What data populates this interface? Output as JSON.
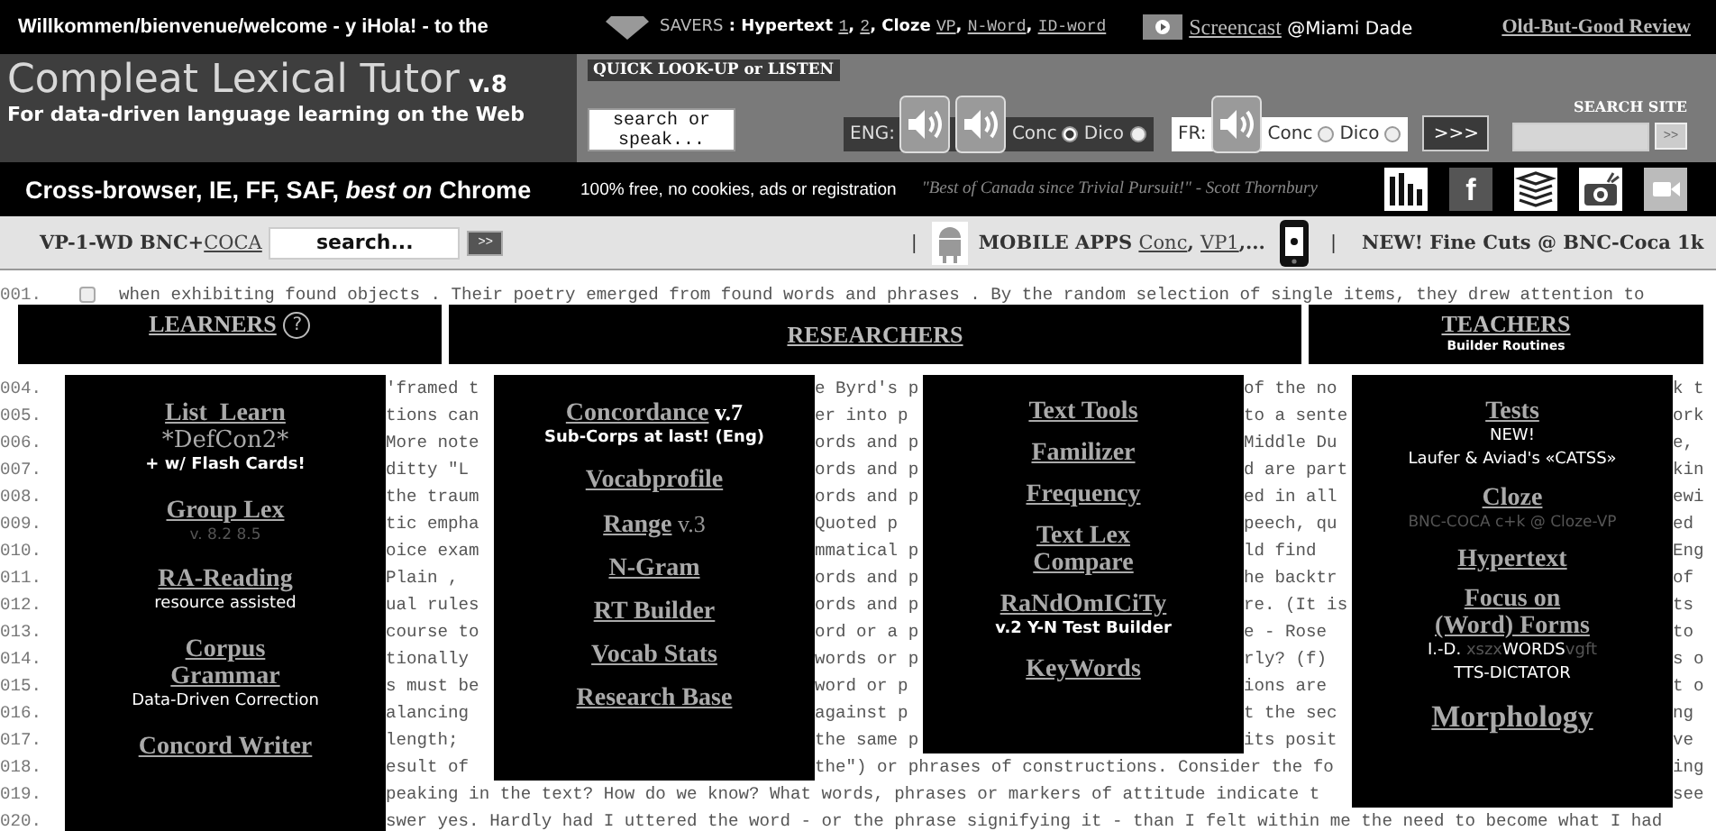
{
  "welcome_bar": {
    "greeting": "Willkommen/bienvenue/welcome - y iHola! - to the",
    "savers": [
      {
        "kind": "label",
        "text": "SAVERS"
      },
      {
        "kind": "text",
        "text": " : Hypertext "
      },
      {
        "kind": "link",
        "text": "1"
      },
      {
        "kind": "text",
        "text": ", "
      },
      {
        "kind": "link",
        "text": "2"
      },
      {
        "kind": "text",
        "text": ", Cloze "
      },
      {
        "kind": "link",
        "text": "VP"
      },
      {
        "kind": "text",
        "text": ", "
      },
      {
        "kind": "link",
        "text": "N-Word"
      },
      {
        "kind": "text",
        "text": ", "
      },
      {
        "kind": "link",
        "text": "ID-word"
      }
    ],
    "screencast": {
      "link": "Screencast",
      "place": " @Miami Dade"
    },
    "review_link": "Old-But-Good Review"
  },
  "title_band": {
    "title": "Compleat Lexical Tutor",
    "version": "v.8",
    "tagline": "For data-driven language learning on the Web"
  },
  "quick_lookup": {
    "label": "QUICK LOOK-UP or LISTEN",
    "placeholder": "search or speak...",
    "languages": [
      {
        "label": "ENG:",
        "kind": "double",
        "options": [
          {
            "label": "Conc",
            "selected": true
          },
          {
            "label": "Dico",
            "selected": false
          }
        ]
      },
      {
        "label": "FR:",
        "kind": "single",
        "options": [
          {
            "label": "Conc",
            "selected": false
          },
          {
            "label": "Dico",
            "selected": false
          }
        ]
      }
    ],
    "go_button": ">>>"
  },
  "site_search": {
    "label": "SEARCH SITE",
    "button": ">>"
  },
  "black_bar": {
    "browser_note": "Cross-browser, IE, FF, SAF, *best on* Chrome",
    "free_note": "100% free, no cookies, ads or registration",
    "quote": "\"Best of Canada since Trivial Pursuit!\" - Scott Thornbury",
    "icons": [
      {
        "kind": "chart"
      },
      {
        "kind": "facebook",
        "glyph": "f"
      },
      {
        "kind": "books"
      },
      {
        "kind": "camera"
      },
      {
        "kind": "video"
      }
    ]
  },
  "grey_bar": {
    "label": "VP-1-WD BNC+",
    "label_link": "COCA",
    "placeholder": "search...",
    "button": ">>",
    "divider": "|",
    "mobile": [
      {
        "kind": "text",
        "text": "MOBILE APPS "
      },
      {
        "kind": "link",
        "text": "Conc"
      },
      {
        "kind": "text",
        "text": ", "
      },
      {
        "kind": "link",
        "text": "VP1"
      },
      {
        "kind": "text",
        "text": ",..."
      }
    ],
    "divider_2": "|",
    "news": "NEW! Fine Cuts @ BNC-Coca 1k"
  },
  "concordance": {
    "first_line": {
      "number": "001.",
      "checked": false,
      "text": "when exhibiting found objects . Their poetry emerged from found words and phrases . By the random selection of single items, they drew attention to"
    },
    "sections": [
      {
        "title": "LEARNERS",
        "help": "?"
      },
      {
        "title": "RESEARCHERS"
      },
      {
        "title": "TEACHERS",
        "subtitle": "Builder Routines"
      }
    ],
    "lines": [
      {
        "number": "004.",
        "segments": [
          "'framed t",
          "e Byrd's p",
          "of the no",
          "k t"
        ]
      },
      {
        "number": "005.",
        "segments": [
          "tions can",
          "er into p",
          "to a sente",
          "ork"
        ]
      },
      {
        "number": "006.",
        "segments": [
          "More note",
          "ords and p",
          "Middle Du",
          "e,"
        ]
      },
      {
        "number": "007.",
        "segments": [
          "ditty \"L",
          "ords and p",
          "d are part",
          "kin"
        ]
      },
      {
        "number": "008.",
        "segments": [
          "the traum",
          "ords and p",
          "ed in all",
          "ewi"
        ]
      },
      {
        "number": "009.",
        "segments": [
          "tic empha",
          "Quoted p",
          "peech, qu",
          "ed"
        ]
      },
      {
        "number": "010.",
        "segments": [
          "oice exam",
          "mmatical p",
          "ld find",
          "Eng"
        ]
      },
      {
        "number": "011.",
        "segments": [
          "Plain ,",
          "ords and p",
          "he backtr",
          "of"
        ]
      },
      {
        "number": "012.",
        "segments": [
          "ual rules",
          "ords and p",
          "re. (It is",
          "ts"
        ]
      },
      {
        "number": "013.",
        "segments": [
          "course to",
          "ord or a p",
          "e - Rose",
          "to"
        ]
      },
      {
        "number": "014.",
        "segments": [
          "tionally",
          "words or p",
          "rly? (f)",
          "s o"
        ]
      },
      {
        "number": "015.",
        "segments": [
          "s must be",
          "word or p",
          "ions are",
          "t o"
        ]
      },
      {
        "number": "016.",
        "segments": [
          "alancing",
          "against p",
          "t the sec",
          "ng"
        ]
      },
      {
        "number": "017.",
        "segments": [
          "length;",
          "the same p",
          "its posit",
          "ve"
        ]
      },
      {
        "number": "018.",
        "segments": [
          "esult of",
          "the\") or phrases of constructions. Consider the fo",
          "ing"
        ]
      },
      {
        "number": "019.",
        "segments": [
          "peaking in the text? How do we know? What words, phrases or markers of attitude indicate t",
          "see"
        ]
      },
      {
        "number": "020.",
        "segments": [
          "swer yes. Hardly had I uttered the word - or the phrase signifying it - than I felt within me the need to become what I had"
        ]
      }
    ],
    "menus": [
      {
        "groups": [
          [
            {
              "kind": "link",
              "text": "List_Learn"
            },
            {
              "kind": "subtitle",
              "text": "*DefCon2*"
            },
            {
              "kind": "note_bold",
              "text": "+ w/ Flash Cards!"
            }
          ],
          [
            {
              "kind": "link",
              "text": "Group Lex"
            },
            {
              "kind": "dim",
              "text": "v. 8.2 8.5"
            }
          ],
          [
            {
              "kind": "link",
              "text": "RA-Reading"
            },
            {
              "kind": "note",
              "text": "resource assisted"
            }
          ],
          [
            {
              "kind": "link",
              "lines": [
                "Corpus",
                "Grammar"
              ]
            },
            {
              "kind": "note",
              "text": "Data-Driven Correction"
            }
          ],
          [
            {
              "kind": "link",
              "text": "Concord Writer"
            }
          ]
        ]
      },
      {
        "groups": [
          [
            {
              "kind": "link",
              "text": "Concordance",
              "suffix": {
                "kind": "bold",
                "text": " v.7"
              }
            },
            {
              "kind": "note_bold",
              "text": "Sub-Corps at last! (Eng)"
            }
          ],
          [
            {
              "kind": "link",
              "text": "Vocabprofile"
            }
          ],
          [
            {
              "kind": "link",
              "text": "Range",
              "suffix": {
                "kind": "plain",
                "text": " v.3"
              }
            }
          ],
          [
            {
              "kind": "link",
              "text": "N-Gram"
            }
          ],
          [
            {
              "kind": "link",
              "text": "RT Builder"
            }
          ],
          [
            {
              "kind": "link",
              "text": "Vocab Stats"
            }
          ],
          [
            {
              "kind": "link",
              "text": "Research Base"
            }
          ]
        ]
      },
      {
        "groups": [
          [
            {
              "kind": "link",
              "text": "Text Tools"
            }
          ],
          [
            {
              "kind": "link",
              "text": "Familizer"
            }
          ],
          [
            {
              "kind": "link",
              "text": "Frequency"
            }
          ],
          [
            {
              "kind": "link",
              "lines": [
                "Text Lex",
                "Compare"
              ]
            }
          ],
          [
            {
              "kind": "link",
              "text": "RaNdOmICiTy"
            },
            {
              "kind": "note_bold",
              "text": "v.2 Y-N Test Builder"
            }
          ],
          [
            {
              "kind": "link",
              "text": "KeyWords"
            }
          ]
        ]
      },
      {
        "groups": [
          [
            {
              "kind": "link",
              "text": "Tests"
            },
            {
              "kind": "note",
              "text": "NEW!"
            },
            {
              "kind": "note",
              "text": "Laufer & Aviad's «CATSS»"
            }
          ],
          [
            {
              "kind": "link",
              "text": "Cloze"
            },
            {
              "kind": "dim",
              "text": "BNC-COCA c+k @ Cloze-VP"
            }
          ],
          [
            {
              "kind": "link",
              "text": "Hypertext"
            }
          ],
          [
            {
              "kind": "link",
              "lines": [
                "Focus on",
                "(Word) Forms"
              ]
            },
            {
              "kind": "mixed",
              "parts": [
                {
                  "text": "I.-D. ",
                  "dim": false
                },
                {
                  "text": "xszx",
                  "dim": true
                },
                {
                  "text": "WORDS",
                  "dim": false
                },
                {
                  "text": "vgft",
                  "dim": true
                }
              ]
            },
            {
              "kind": "note",
              "text": "TTS-DICTATOR"
            }
          ],
          [
            {
              "kind": "link_large",
              "text": "Morphology"
            }
          ]
        ]
      }
    ]
  }
}
